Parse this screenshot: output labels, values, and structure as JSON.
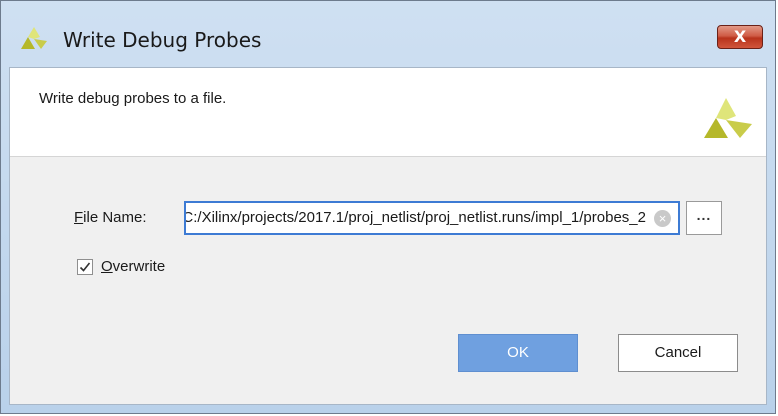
{
  "window": {
    "title": "Write Debug Probes",
    "close_label": "X"
  },
  "header": {
    "description": "Write debug probes to a file."
  },
  "form": {
    "file_name_label_mnemonic": "F",
    "file_name_label_rest": "ile Name:",
    "file_name_value": "C:/Xilinx/projects/2017.1/proj_netlist/proj_netlist.runs/impl_1/probes_2",
    "browse_label": "...",
    "overwrite_checked": true,
    "overwrite_label_mnemonic": "O",
    "overwrite_label_rest": "verwrite"
  },
  "buttons": {
    "ok": "OK",
    "cancel": "Cancel"
  },
  "colors": {
    "accent": "#3d7bd4",
    "ok_button": "#6fa0e0",
    "logo_light": "#dfe57a",
    "logo_dark": "#b5b82a"
  },
  "icons": {
    "title": "xilinx-logo-icon",
    "header": "xilinx-logo-icon",
    "clear": "clear-circle-icon",
    "check": "checkmark-icon"
  }
}
